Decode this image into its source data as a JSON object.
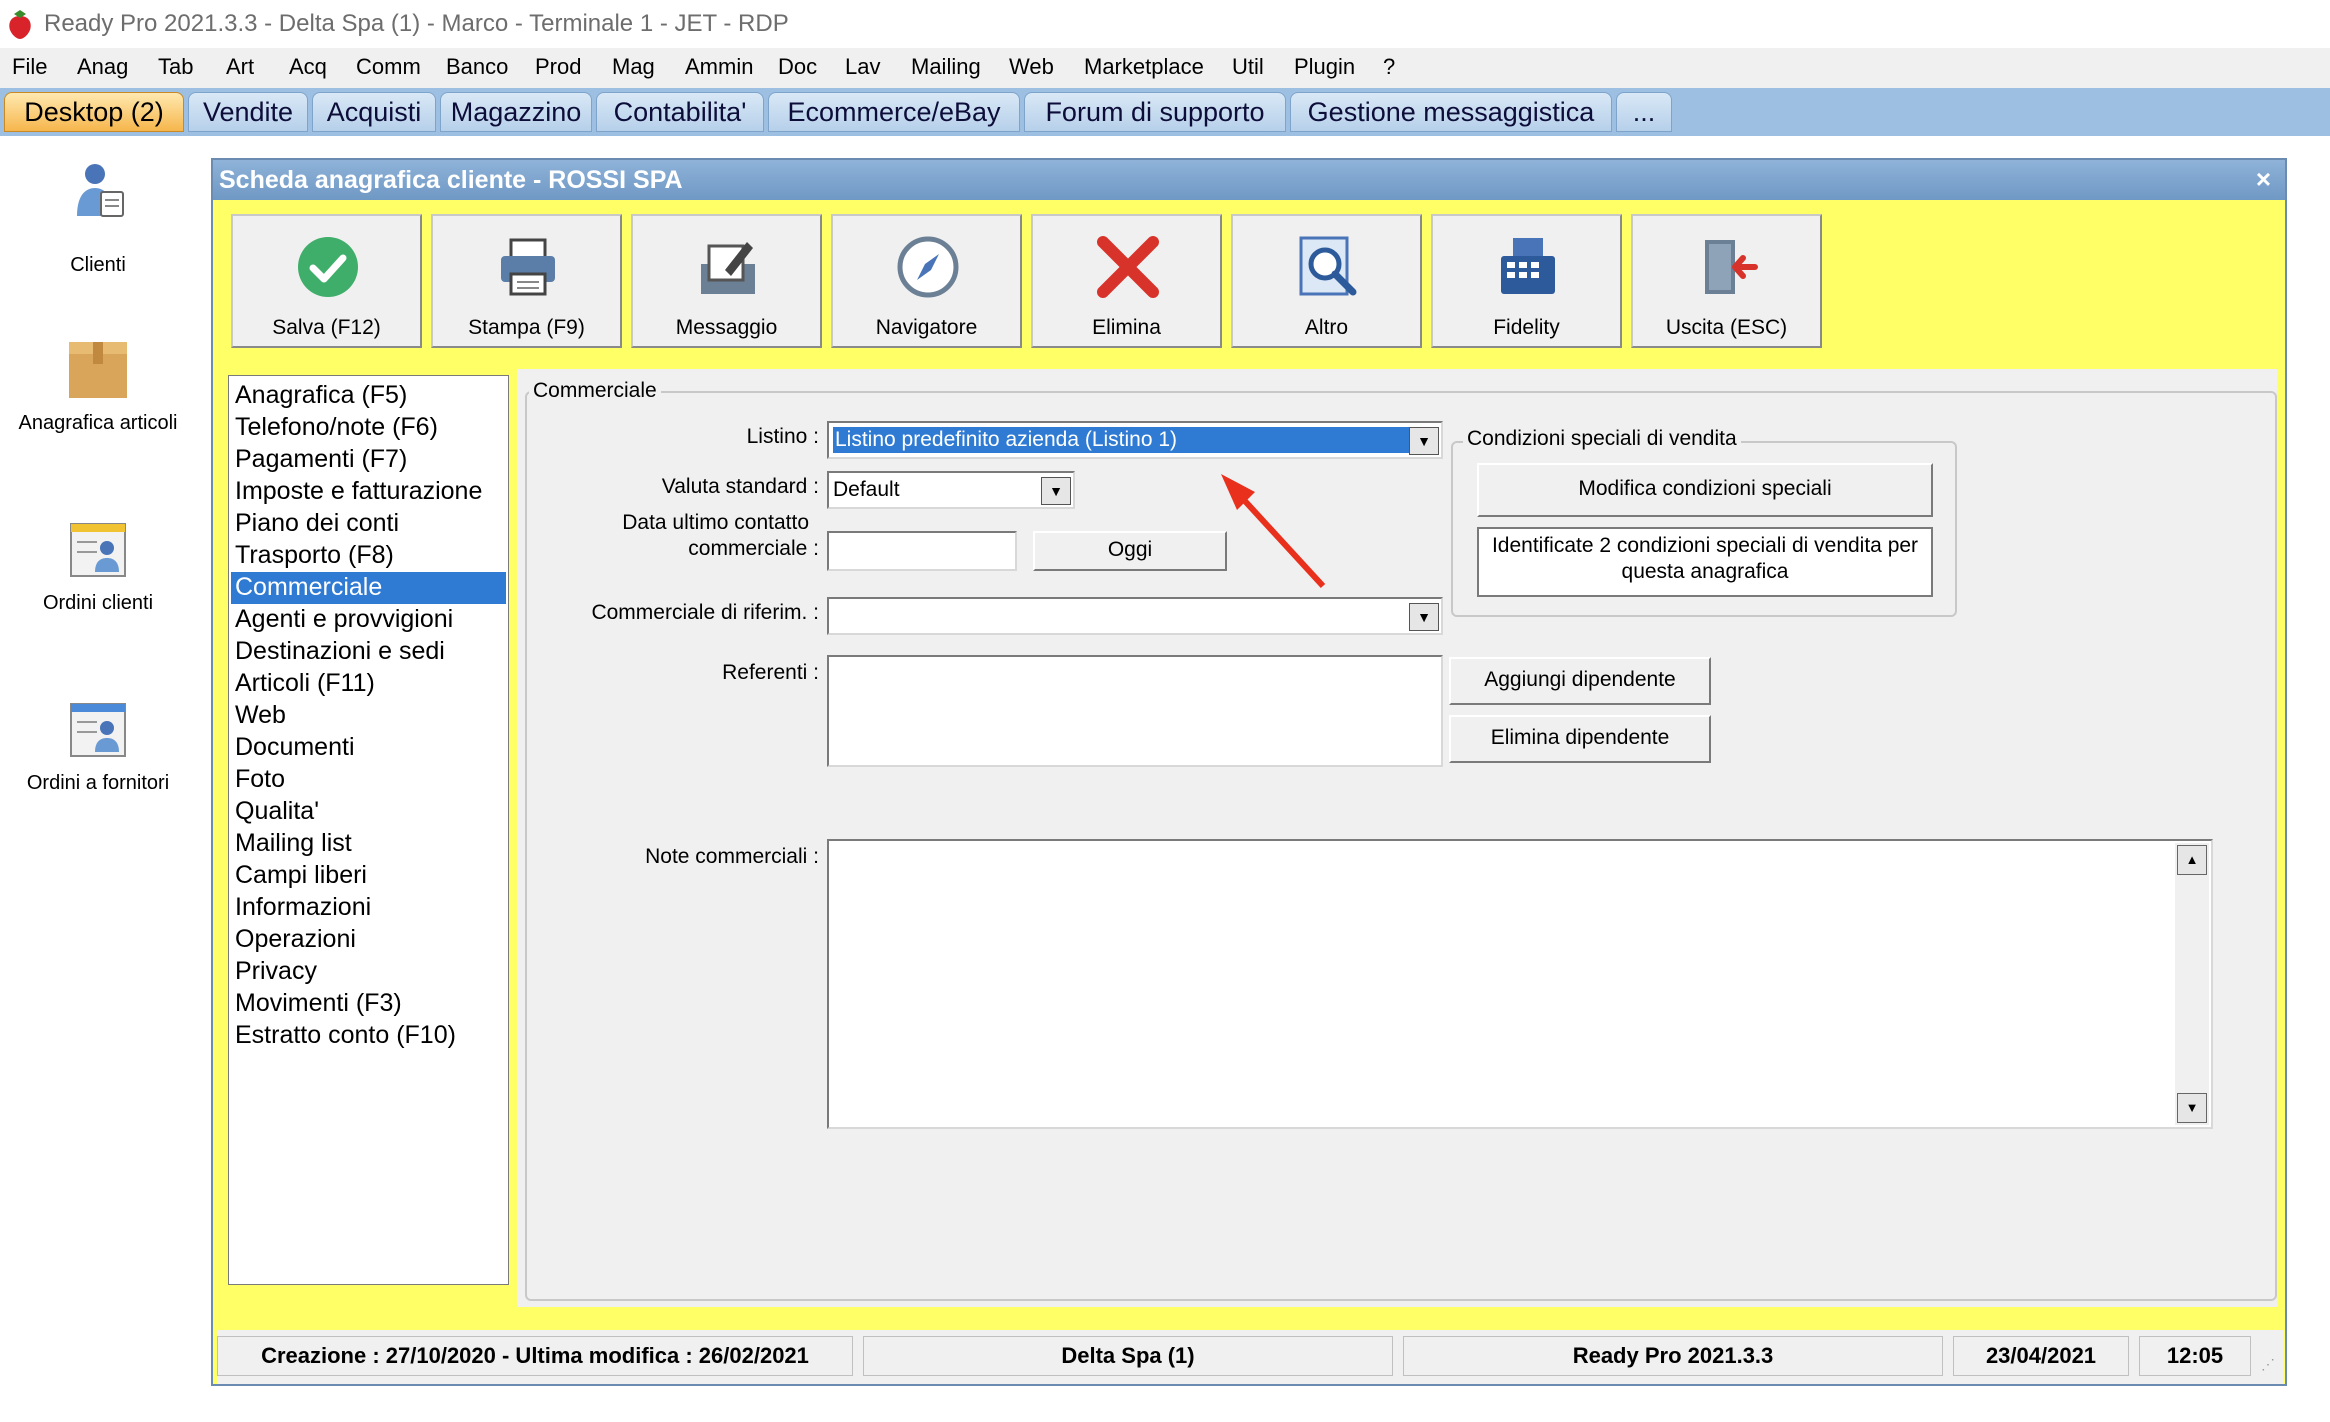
{
  "app": {
    "title": "Ready Pro 2021.3.3 - Delta Spa (1) - Marco - Terminale 1 - JET - RDP"
  },
  "menu": [
    "File",
    "Anag",
    "Tab",
    "Art",
    "Acq",
    "Comm",
    "Banco",
    "Prod",
    "Mag",
    "Ammin",
    "Doc",
    "Lav",
    "Mailing",
    "Web",
    "Marketplace",
    "Util",
    "Plugin",
    "?"
  ],
  "tabs": [
    "Desktop (2)",
    "Vendite",
    "Acquisti",
    "Magazzino",
    "Contabilita'",
    "Ecommerce/eBay",
    "Forum di supporto",
    "Gestione messaggistica",
    "..."
  ],
  "desktop_icons": [
    "Clienti",
    "Anagrafica articoli",
    "Ordini clienti",
    "Ordini a fornitori"
  ],
  "window": {
    "title": "Scheda anagrafica cliente - ROSSI SPA",
    "close": "×"
  },
  "toolbar": [
    "Salva (F12)",
    "Stampa (F9)",
    "Messaggio",
    "Navigatore",
    "Elimina",
    "Altro",
    "Fidelity",
    "Uscita (ESC)"
  ],
  "nav": [
    "Anagrafica (F5)",
    "Telefono/note (F6)",
    "Pagamenti (F7)",
    "Imposte e fatturazione",
    "Piano dei conti",
    "Trasporto (F8)",
    "Commerciale",
    "Agenti e provvigioni",
    "Destinazioni e sedi",
    "Articoli (F11)",
    "Web",
    "Documenti",
    "Foto",
    "Qualita'",
    "Mailing list",
    "Campi liberi",
    "Informazioni",
    "Operazioni",
    "Privacy",
    "Movimenti (F3)",
    "Estratto conto (F10)"
  ],
  "nav_selected": "Commerciale",
  "form": {
    "group_title": "Commerciale",
    "listino_label": "Listino :",
    "listino_value": "Listino predefinito azienda (Listino 1)",
    "valuta_label": "Valuta standard :",
    "valuta_value": "Default",
    "data_label_1": "Data ultimo contatto",
    "data_label_2": "commerciale :",
    "data_value": "",
    "oggi_button": "Oggi",
    "riferim_label": "Commerciale di riferim. :",
    "riferim_value": "",
    "referenti_label": "Referenti :",
    "aggiungi_button": "Aggiungi dipendente",
    "elimina_dip_button": "Elimina dipendente",
    "note_label": "Note commerciali :",
    "note_value": ""
  },
  "special": {
    "title": "Condizioni speciali di vendita",
    "modify_button": "Modifica condizioni speciali",
    "info_line1": "Identificate 2 condizioni speciali di vendita per",
    "info_line2": "questa anagrafica"
  },
  "status": {
    "creation": "Creazione : 27/10/2020 - Ultima modifica : 26/02/2021",
    "company": "Delta Spa (1)",
    "version": "Ready Pro 2021.3.3",
    "date": "23/04/2021",
    "time": "12:05"
  },
  "colors": {
    "window_bg": "#ffff66",
    "selection": "#2f7bd3",
    "arrow": "#e8301c"
  }
}
